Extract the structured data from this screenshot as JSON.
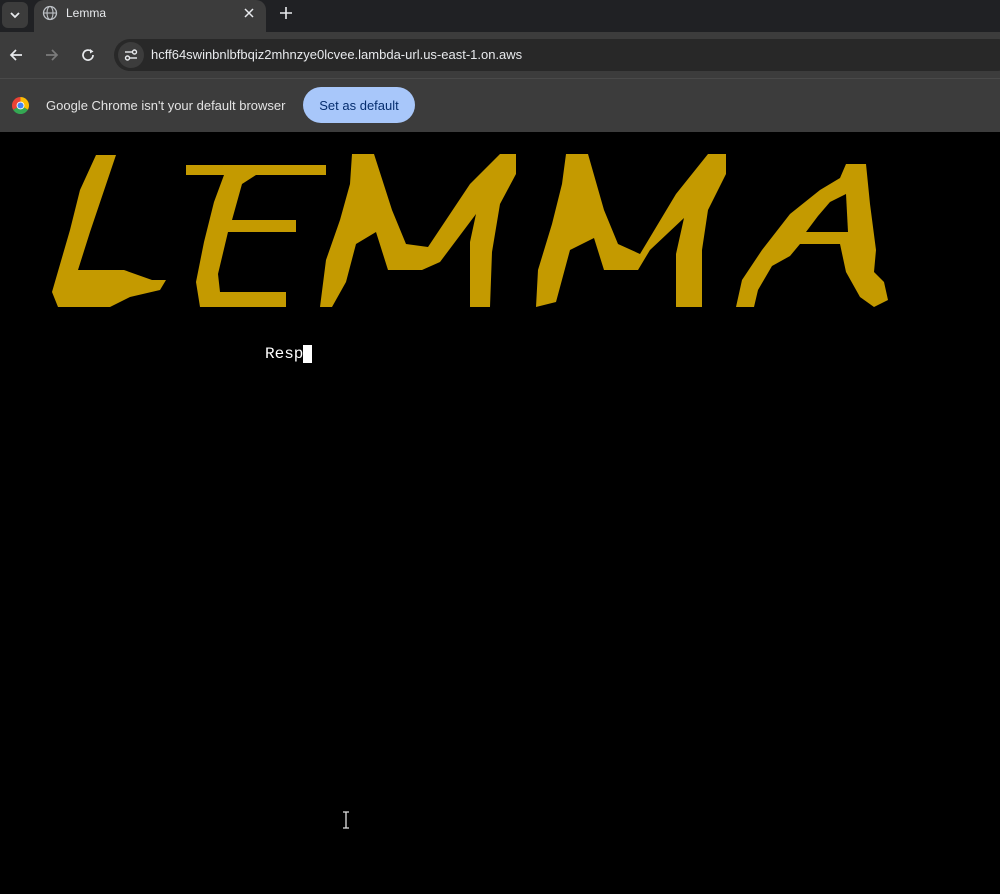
{
  "tab": {
    "title": "Lemma",
    "favicon": "globe-icon"
  },
  "toolbar": {
    "url": "hcff64swinbnlbfbqiz2mhnzye0lcvee.lambda-url.us-east-1.on.aws",
    "icons": [
      "back-arrow-icon",
      "forward-arrow-icon",
      "reload-icon",
      "site-info-icon"
    ]
  },
  "infobar": {
    "message": "Google Chrome isn't your default browser",
    "button_label": "Set as default"
  },
  "page": {
    "logo_text": "LEMMA",
    "logo_color": "#c49a00",
    "prompt_text": "Resp"
  }
}
